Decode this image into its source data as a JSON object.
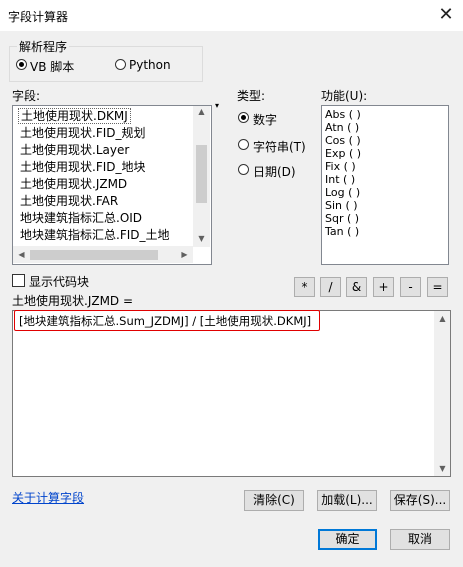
{
  "window": {
    "title": "字段计算器"
  },
  "parser": {
    "legend": "解析程序",
    "options": [
      {
        "label": "VB 脚本",
        "selected": true
      },
      {
        "label": "Python",
        "selected": false
      }
    ]
  },
  "fields": {
    "label": "字段:",
    "items": [
      "土地使用现状.DKMJ",
      "土地使用现状.FID_规划",
      "土地使用现状.Layer",
      "土地使用现状.FID_地块",
      "土地使用现状.JZMD",
      "土地使用现状.FAR",
      "地块建筑指标汇总.OID",
      "地块建筑指标汇总.FID_土地"
    ]
  },
  "type": {
    "label": "类型:",
    "options": [
      {
        "label": "数字",
        "selected": true
      },
      {
        "label": "字符串(T)",
        "selected": false
      },
      {
        "label": "日期(D)",
        "selected": false
      }
    ]
  },
  "functions": {
    "label": "功能(U):",
    "items": [
      "Abs ( )",
      "Atn ( )",
      "Cos ( )",
      "Exp ( )",
      "Fix ( )",
      "Int ( )",
      "Log ( )",
      "Sin ( )",
      "Sqr ( )",
      "Tan ( )"
    ]
  },
  "show_codeblock": {
    "label": "显示代码块",
    "checked": false
  },
  "operators": [
    "*",
    "/",
    "&",
    "+",
    "-",
    "="
  ],
  "expression": {
    "target_label": "土地使用现状.JZMD =",
    "value": "[地块建筑指标汇总.Sum_JZDMJ] / [土地使用现状.DKMJ]"
  },
  "footer": {
    "about_link": "关于计算字段",
    "clear": "清除(C)",
    "load": "加载(L)...",
    "save": "保存(S)...",
    "ok": "确定",
    "cancel": "取消"
  }
}
